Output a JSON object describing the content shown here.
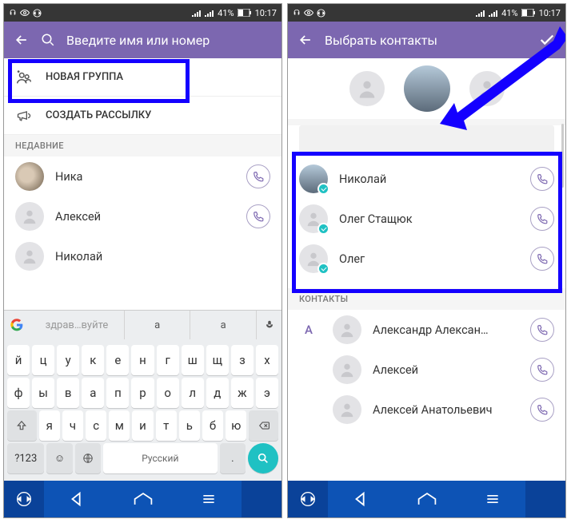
{
  "status": {
    "time": "10:17",
    "battery": "41%"
  },
  "left": {
    "search_placeholder": "Введите имя или номер",
    "actions": {
      "new_group": "НОВАЯ ГРУППА",
      "broadcast": "СОЗДАТЬ РАССЫЛКУ"
    },
    "section_recent": "НЕДАВНИЕ",
    "contacts": [
      "Ника",
      "Алексей",
      "Николай"
    ],
    "keyboard": {
      "suggestions": [
        "здрав…вуйте",
        "а",
        "а"
      ],
      "row1": [
        "й",
        "ц",
        "у",
        "к",
        "е",
        "н",
        "г",
        "ш",
        "щ",
        "з",
        "х"
      ],
      "row2": [
        "ф",
        "ы",
        "в",
        "а",
        "п",
        "р",
        "о",
        "л",
        "д",
        "ж",
        "э"
      ],
      "row3": [
        "я",
        "ч",
        "с",
        "м",
        "и",
        "т",
        "ь",
        "б",
        "ю"
      ],
      "numkey": "?123",
      "lang": "Русский"
    }
  },
  "right": {
    "title": "Выбрать контакты",
    "selected_contacts": [
      "Николай",
      "Олег Стащюк",
      "Олег"
    ],
    "section_contacts": "КОНТАКТЫ",
    "anchor": "А",
    "contacts": [
      "Александр Алексан…",
      "Алексей",
      "Алексей Анатольевич"
    ]
  }
}
